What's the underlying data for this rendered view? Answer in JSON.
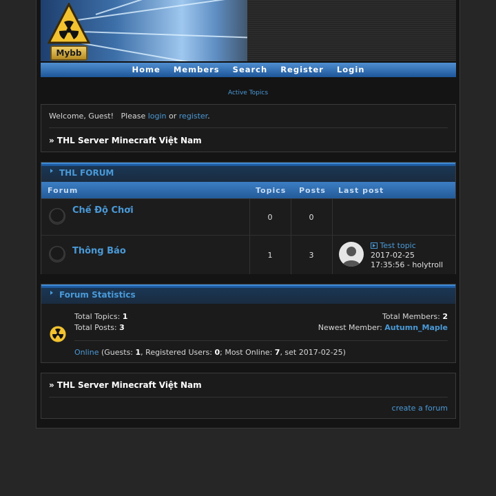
{
  "logo": {
    "text": "Mybb"
  },
  "nav": {
    "items": [
      {
        "label": "Home"
      },
      {
        "label": "Members"
      },
      {
        "label": "Search"
      },
      {
        "label": "Register"
      },
      {
        "label": "Login"
      }
    ]
  },
  "active_topics": "Active Topics",
  "welcome": {
    "prefix": "Welcome, Guest!   Please ",
    "login": "login",
    "or": " or ",
    "register": "register",
    "suffix": "."
  },
  "breadcrumb": {
    "text": "» THL Server Minecraft Việt Nam"
  },
  "forum_section": {
    "title": "THL FORUM",
    "columns": {
      "forum": "Forum",
      "topics": "Topics",
      "posts": "Posts",
      "last_post": "Last post"
    },
    "rows": [
      {
        "name": "Chế Độ Chơi",
        "topics": "0",
        "posts": "0"
      },
      {
        "name": "Thông Báo",
        "topics": "1",
        "posts": "3",
        "last_post": {
          "title": "Test topic",
          "date": "2017-02-25",
          "time_author": "17:35:56 - holytroll"
        }
      }
    ]
  },
  "stats": {
    "title": "Forum Statistics",
    "total_topics_label": "Total Topics: ",
    "total_topics": "1",
    "total_posts_label": "Total Posts: ",
    "total_posts": "3",
    "total_members_label": "Total Members: ",
    "total_members": "2",
    "newest_member_label": "Newest Member: ",
    "newest_member": "Autumn_Maple",
    "online_link": "Online",
    "guests_label": " (Guests: ",
    "guests": "1",
    "registered_label": ", Registered Users: ",
    "registered": "0",
    "most_online_label": "; Most Online: ",
    "most_online": "7",
    "set_date": ", set 2017-02-25)"
  },
  "footer": {
    "breadcrumb": "» THL Server Minecraft Việt Nam",
    "create_forum": "create a forum"
  },
  "colors": {
    "accent": "#4a9ad8",
    "nav_bar": "#2f6fb5",
    "background": "#141414"
  }
}
